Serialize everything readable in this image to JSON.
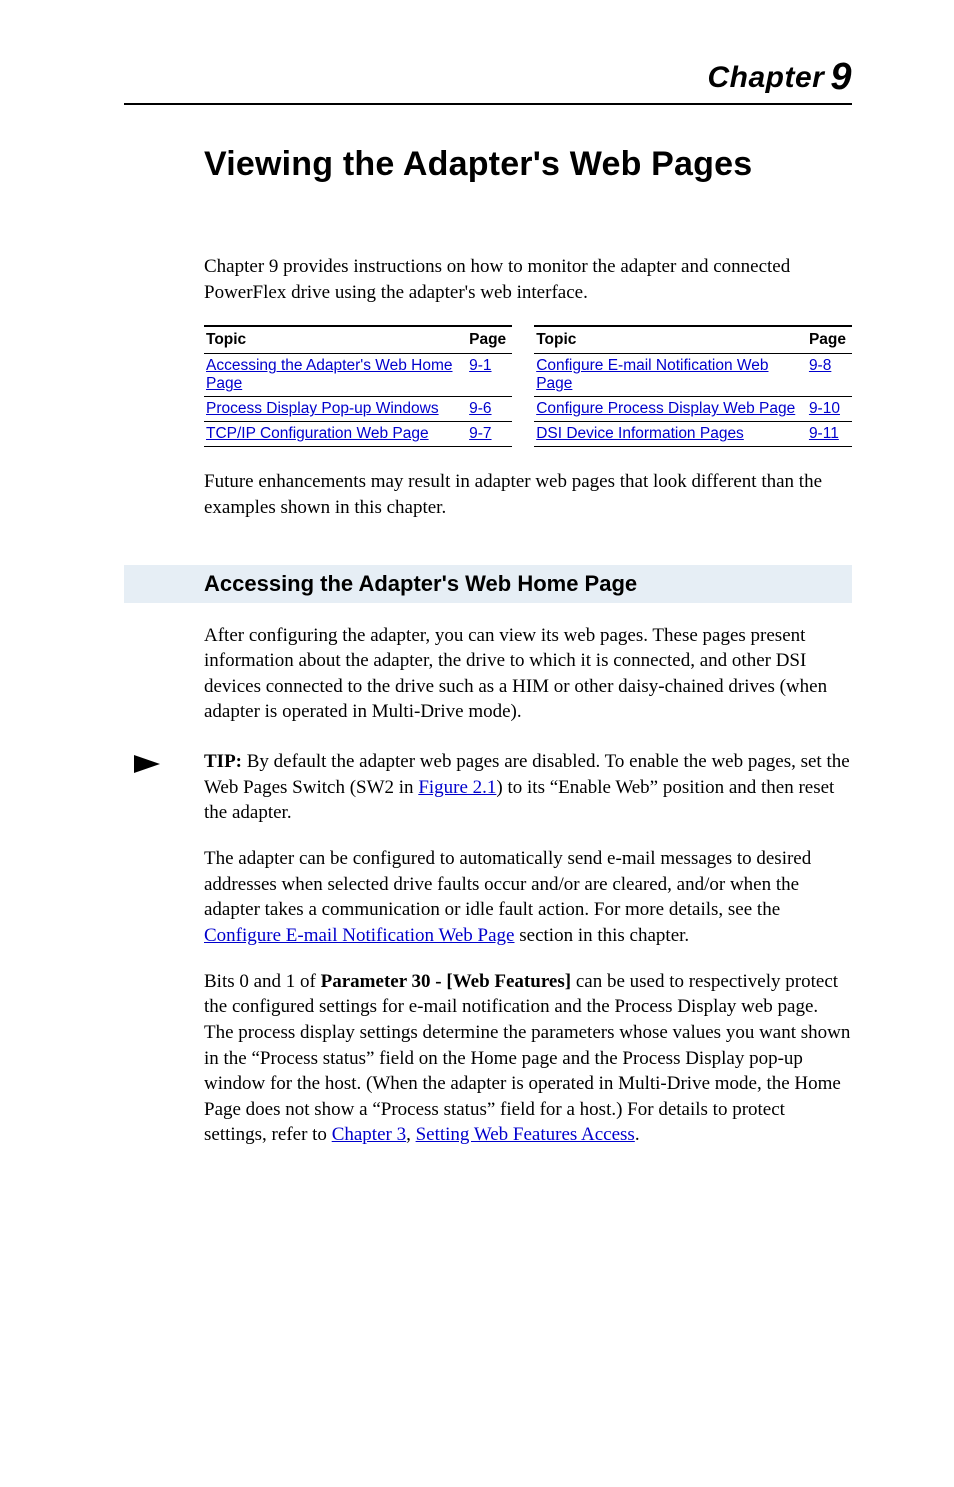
{
  "header": {
    "chapter_word": "Chapter",
    "chapter_num": "9"
  },
  "title": "Viewing the Adapter's Web Pages",
  "intro": "Chapter 9 provides instructions on how to monitor the adapter and connected PowerFlex drive using the adapter's web interface.",
  "toc": {
    "col_topic": "Topic",
    "col_page": "Page",
    "left": [
      {
        "topic": "Accessing the Adapter's Web Home Page",
        "page": "9-1"
      },
      {
        "topic": "Process Display Pop-up Windows",
        "page": "9-6"
      },
      {
        "topic": "TCP/IP Configuration Web Page",
        "page": "9-7"
      }
    ],
    "right": [
      {
        "topic": "Configure E-mail Notification Web Page",
        "page": "9-8"
      },
      {
        "topic": "Configure Process Display Web Page",
        "page": "9-10"
      },
      {
        "topic": "DSI Device Information Pages",
        "page": "9-11"
      }
    ]
  },
  "after_toc": "Future enhancements may result in adapter web pages that look different than the examples shown in this chapter.",
  "section_heading": "Accessing the Adapter's Web Home Page",
  "para1": "After configuring the adapter, you can view its web pages. These pages present information about the adapter, the drive to which it is connected, and other DSI devices connected to the drive such as a HIM or other daisy-chained drives (when adapter is operated in Multi-Drive mode).",
  "tip": {
    "label": "TIP:",
    "t1": "By default the adapter web pages are disabled. To enable the web pages, set the Web Pages Switch (SW2 in ",
    "link1": "Figure 2.1",
    "t2": ") to its “Enable Web” position and then reset the adapter."
  },
  "para2": {
    "t1": "The adapter can be configured to automatically send e-mail messages to desired addresses when selected drive faults occur and/or are cleared, and/or when the adapter takes a communication or idle fault action. For more details, see the ",
    "link1": "Configure E-mail Notification Web Page",
    "t2": " section in this chapter."
  },
  "para3": {
    "t1": "Bits 0 and 1 of ",
    "bold": "Parameter 30 - [Web Features]",
    "t2": " can be used to respectively protect the configured settings for e-mail notification and the Process Display web page. The process display settings determine the parameters whose values you want shown in the “Process status” field on the Home page and the Process Display pop-up window for the host. (When the adapter is operated in Multi-Drive mode, the Home Page does not show a “Process status” field for a host.) For details to protect settings, refer to ",
    "link1": "Chapter 3",
    "t3": ", ",
    "link2": "Setting Web Features Access",
    "t4": "."
  }
}
